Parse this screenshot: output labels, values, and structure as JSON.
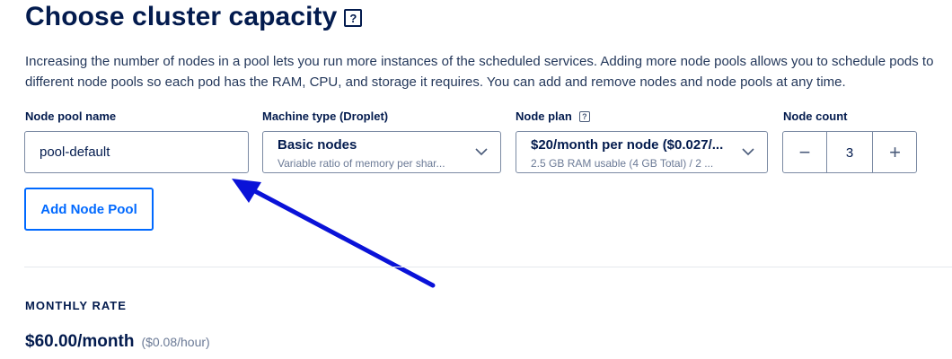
{
  "header": {
    "title": "Choose cluster capacity",
    "help_icon": "help-icon"
  },
  "description": "Increasing the number of nodes in a pool lets you run more instances of the scheduled services. Adding more node pools allows you to schedule pods to different node pools so each pod has the RAM, CPU, and storage it requires. You can add and remove nodes and node pools at any time.",
  "pool": {
    "name_label": "Node pool name",
    "name_value": "pool-default",
    "machine_type_label": "Machine type (Droplet)",
    "machine_type_value": "Basic nodes",
    "machine_type_sub": "Variable ratio of memory per shar...",
    "node_plan_label": "Node plan",
    "node_plan_value": "$20/month per node ($0.027/...",
    "node_plan_sub": "2.5 GB RAM usable (4 GB Total) / 2 ...",
    "node_count_label": "Node count",
    "node_count_value": "3",
    "decrement_symbol": "−",
    "increment_symbol": "+"
  },
  "actions": {
    "add_pool_label": "Add Node Pool"
  },
  "rate": {
    "label": "MONTHLY RATE",
    "monthly": "$60.00/month",
    "hourly": "($0.08/hour)"
  },
  "colors": {
    "heading": "#031b4e",
    "accent": "#0069ff",
    "annotation_arrow": "#0a12d8"
  }
}
